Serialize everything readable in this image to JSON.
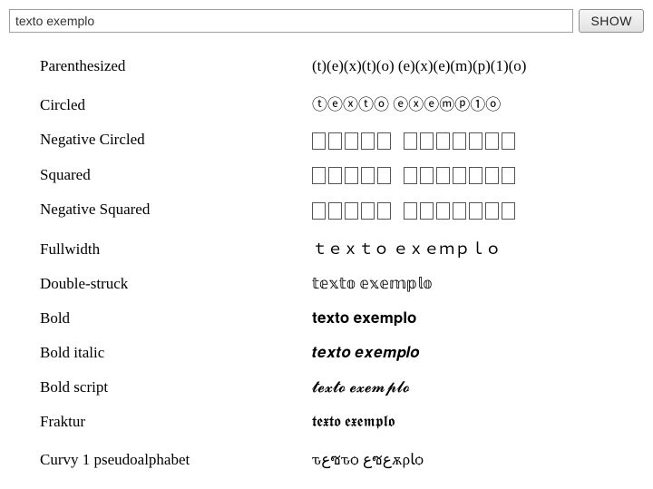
{
  "input": {
    "value": "texto exemplo",
    "placeholder": ""
  },
  "button": {
    "label": "SHOW"
  },
  "rows": [
    {
      "label": "Parenthesized",
      "value": "(t)(e)(x)(t)(o) (e)(x)(e)(m)(p)(1)(o)"
    },
    {
      "label": "Circled",
      "value": "ⓣⓔⓧⓣⓞ ⓔⓧⓔⓜⓟ①ⓞ"
    },
    {
      "label": "Negative Circled",
      "boxes": [
        5,
        7
      ]
    },
    {
      "label": "Squared",
      "boxes": [
        5,
        7
      ]
    },
    {
      "label": "Negative Squared",
      "boxes": [
        5,
        7
      ]
    },
    {
      "label": "Fullwidth",
      "value": "ｔｅｘｔｏ ｅｘｅｍｐｌｏ"
    },
    {
      "label": "Double-struck",
      "value": "𝕥𝕖𝕩𝕥𝕠 𝕖𝕩𝕖𝕞𝕡𝕝𝕠"
    },
    {
      "label": "Bold",
      "value": "𝐭𝐞𝐱𝐭𝐨 𝐞𝐱𝐞𝐦𝐩𝐥𝐨"
    },
    {
      "label": "Bold italic",
      "value": "𝒕𝒆𝒙𝒕𝒐 𝒆𝒙𝒆𝒎𝒑𝒍𝒐"
    },
    {
      "label": "Bold script",
      "value": "𝓽𝓮𝔁𝓽𝓸 𝓮𝔁𝓮𝓶𝓹𝓵𝓸"
    },
    {
      "label": "Fraktur",
      "value": "𝖙𝖊𝖝𝖙𝖔 𝖊𝖝𝖊𝖒𝖕𝖑𝖔"
    },
    {
      "label": "Curvy 1 pseudoalphabet",
      "value": "ԏﻉซԏѻ ﻉซﻉѫρﺎѻ"
    }
  ]
}
